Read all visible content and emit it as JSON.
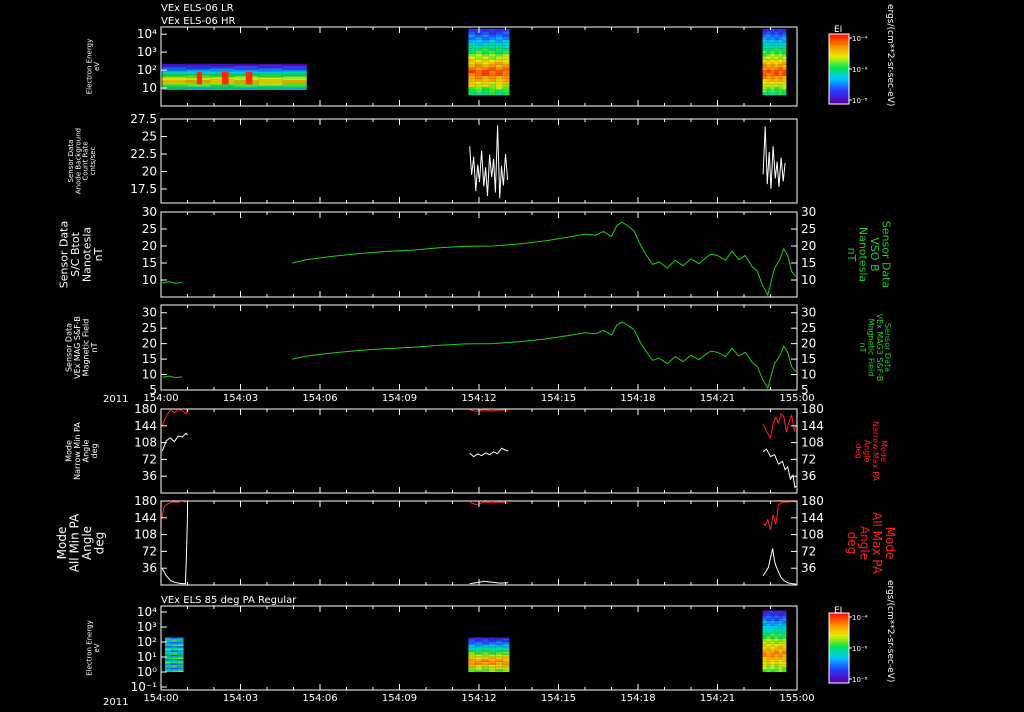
{
  "figure": {
    "header_lines": [
      "VEx ELS-06 LR",
      "VEx ELS-06 HR"
    ],
    "panel7_title": "VEx ELS 85 deg PA Regular",
    "year_label": "2011",
    "colorbar_label": "EI",
    "colorbar_unit": "ergs/(cm**2-sr-sec-eV)",
    "colorbar_ticks": [
      "10⁻⁴",
      "10⁻⁶",
      "10⁻⁸"
    ],
    "x_ticks": [
      "154:00",
      "154:03",
      "154:06",
      "154:09",
      "154:12",
      "154:15",
      "154:18",
      "154:21",
      "155:00"
    ]
  },
  "colors": {
    "background": "#000000",
    "axes": "#ffffff",
    "green": "#22cc22",
    "red": "#ff2020",
    "white": "#ffffff"
  },
  "chart_data": [
    {
      "type": "heatmap",
      "ylabel": [
        "Electron Energy",
        "eV"
      ],
      "yticks": [
        "10⁴",
        "10³",
        "10²",
        "10"
      ],
      "ylim_exp": [
        0,
        4.4
      ],
      "blocks": [
        {
          "x0": 0.05,
          "x1": 5.5,
          "e0": 0.9,
          "e1": 2.35,
          "style": "lr"
        },
        {
          "x0": 11.6,
          "x1": 13.15,
          "e0": 0.6,
          "e1": 4.3,
          "style": "hr"
        },
        {
          "x0": 22.7,
          "x1": 23.6,
          "e0": 0.6,
          "e1": 4.3,
          "style": "hr"
        }
      ]
    },
    {
      "type": "line",
      "ylabel": [
        "Sensor Data",
        "Anode Background",
        "Count Rate",
        "cnts/sec"
      ],
      "yticks": [
        17.5,
        20.0,
        22.5,
        25.0,
        27.5
      ],
      "ylim": [
        15.5,
        27.5
      ],
      "series": [
        {
          "color": "white",
          "segment": "a",
          "x": [
            11.65,
            11.72,
            11.8,
            11.88,
            11.95,
            12.02,
            12.1,
            12.18,
            12.25,
            12.32,
            12.4,
            12.48,
            12.55,
            12.62,
            12.7,
            12.78,
            12.85,
            12.92,
            13.0,
            13.08
          ],
          "y": [
            23.6,
            19.5,
            22.1,
            17.2,
            21.0,
            18.5,
            23.0,
            17.9,
            20.6,
            16.5,
            22.4,
            19.2,
            21.8,
            17.0,
            26.6,
            16.2,
            20.8,
            18.0,
            22.5,
            18.8
          ]
        },
        {
          "color": "white",
          "segment": "b",
          "x": [
            22.72,
            22.8,
            22.88,
            22.95,
            23.02,
            23.1,
            23.18,
            23.25,
            23.32,
            23.4,
            23.48,
            23.55
          ],
          "y": [
            19.6,
            26.4,
            18.2,
            22.8,
            17.5,
            23.6,
            19.0,
            21.4,
            17.8,
            22.0,
            18.6,
            21.2
          ]
        }
      ]
    },
    {
      "type": "line",
      "ylabel_left": [
        "Sensor Data",
        "S/C Btot",
        "Nanotesla",
        "nT"
      ],
      "ylabel_right": [
        "Sensor Data",
        "VSO B",
        "Nanotesla",
        "nT"
      ],
      "yticks": [
        10,
        15,
        20,
        25,
        30
      ],
      "ylim": [
        5,
        30
      ],
      "series": [
        {
          "color": "green",
          "x": [
            0.05,
            0.3,
            0.55,
            0.8
          ],
          "y": [
            9.1,
            9.5,
            9.0,
            9.3
          ]
        },
        {
          "color": "green",
          "x": [
            4.95,
            5.5,
            6.5,
            7.5,
            8.5,
            9.5,
            10.5,
            11.5,
            12.5,
            13.5,
            14.5,
            15.5,
            16.0,
            16.4,
            16.7,
            17.0,
            17.2,
            17.4,
            17.6,
            17.85,
            18.1,
            18.3,
            18.55,
            18.8,
            19.1,
            19.4,
            19.7,
            20.0,
            20.3,
            20.55,
            20.75,
            21.0,
            21.3,
            21.55,
            21.8,
            22.05,
            22.3,
            22.5,
            22.7,
            22.9,
            23.15,
            23.35,
            23.5,
            23.65,
            23.8,
            23.95
          ],
          "y": [
            15.0,
            16.0,
            17.0,
            17.8,
            18.4,
            18.8,
            19.5,
            19.9,
            20.0,
            20.6,
            21.5,
            22.8,
            23.5,
            23.2,
            24.3,
            22.8,
            26.0,
            27.0,
            26.0,
            24.5,
            20.2,
            17.5,
            14.6,
            15.3,
            13.5,
            15.8,
            14.2,
            16.2,
            14.8,
            16.5,
            17.6,
            17.2,
            15.8,
            18.5,
            16.0,
            17.2,
            14.0,
            12.6,
            8.5,
            5.6,
            13.5,
            16.0,
            19.2,
            17.2,
            12.5,
            11.0
          ]
        }
      ]
    },
    {
      "type": "line",
      "ylabel_left": [
        "Sensor Data",
        "VEx MAG S&F-B",
        "Magnetic Field",
        "nT"
      ],
      "ylabel_right": [
        "Sensor Data",
        "VEx MAG3 S&F-B",
        "Magnetic Field",
        "nT"
      ],
      "yticks": [
        5,
        10,
        15,
        20,
        25,
        30
      ],
      "ylim": [
        5,
        32.5
      ],
      "series": [
        {
          "color": "green",
          "x": [
            0.05,
            0.3,
            0.55,
            0.8
          ],
          "y": [
            9.1,
            9.5,
            9.0,
            9.3
          ]
        },
        {
          "color": "green",
          "x": [
            4.95,
            5.5,
            6.5,
            7.5,
            8.5,
            9.5,
            10.5,
            11.5,
            12.5,
            13.5,
            14.5,
            15.5,
            16.0,
            16.4,
            16.7,
            17.0,
            17.2,
            17.4,
            17.6,
            17.85,
            18.1,
            18.3,
            18.55,
            18.8,
            19.1,
            19.4,
            19.7,
            20.0,
            20.3,
            20.55,
            20.75,
            21.0,
            21.3,
            21.55,
            21.8,
            22.05,
            22.3,
            22.5,
            22.7,
            22.9,
            23.15,
            23.35,
            23.5,
            23.65,
            23.8,
            23.95
          ],
          "y": [
            15.0,
            16.0,
            17.0,
            17.8,
            18.4,
            18.8,
            19.5,
            19.9,
            20.0,
            20.6,
            21.5,
            22.8,
            23.5,
            23.2,
            24.3,
            22.8,
            26.0,
            27.0,
            26.0,
            24.5,
            20.2,
            17.5,
            14.6,
            15.3,
            13.5,
            15.8,
            14.2,
            16.2,
            14.8,
            16.5,
            17.6,
            17.2,
            15.8,
            18.5,
            16.0,
            17.2,
            14.0,
            12.6,
            8.5,
            5.6,
            13.5,
            16.0,
            19.2,
            17.2,
            12.5,
            11.0
          ]
        }
      ]
    },
    {
      "type": "line",
      "ylabel_left": [
        "Mode",
        "Narrow Min PA",
        "Angle",
        "deg"
      ],
      "ylabel_right": [
        "Mode",
        "Narrow Max PA",
        "Angle",
        "deg"
      ],
      "yticks": [
        36,
        72,
        108,
        144,
        180
      ],
      "ylim": [
        0,
        180
      ],
      "series": [
        {
          "color": "red",
          "x": [
            0.05,
            0.2,
            0.35,
            0.5,
            0.65,
            0.8,
            0.95,
            1.0
          ],
          "y": [
            145,
            165,
            178,
            172,
            179,
            176,
            170,
            180
          ]
        },
        {
          "color": "white",
          "x": [
            0.05,
            0.2,
            0.35,
            0.5,
            0.65,
            0.8,
            0.95,
            1.0
          ],
          "y": [
            90,
            112,
            118,
            110,
            122,
            120,
            128,
            124
          ]
        },
        {
          "color": "red",
          "x": [
            11.65,
            11.9,
            12.2,
            12.5,
            12.8,
            13.1
          ],
          "y": [
            178,
            175,
            178,
            176,
            178,
            177
          ]
        },
        {
          "color": "white",
          "x": [
            11.65,
            11.8,
            11.95,
            12.1,
            12.25,
            12.4,
            12.55,
            12.7,
            12.85,
            13.0,
            13.1
          ],
          "y": [
            85,
            78,
            84,
            80,
            86,
            82,
            88,
            84,
            96,
            92,
            90
          ]
        },
        {
          "color": "red",
          "x": [
            22.72,
            22.85,
            23.0,
            23.1,
            23.2,
            23.3,
            23.4,
            23.5,
            23.6,
            23.7,
            23.8,
            23.9,
            23.97
          ],
          "y": [
            148,
            132,
            118,
            148,
            162,
            150,
            170,
            164,
            130,
            152,
            166,
            134,
            145
          ]
        },
        {
          "color": "white",
          "x": [
            22.72,
            22.85,
            23.0,
            23.15,
            23.3,
            23.45,
            23.55,
            23.65,
            23.75,
            23.85,
            23.92,
            23.97
          ],
          "y": [
            88,
            94,
            78,
            82,
            62,
            68,
            50,
            56,
            30,
            38,
            12,
            15
          ]
        }
      ]
    },
    {
      "type": "line",
      "ylabel_left": [
        "Mode",
        "All Min PA",
        "Angle",
        "deg"
      ],
      "ylabel_right": [
        "Mode",
        "All Max PA",
        "Angle",
        "deg"
      ],
      "yticks": [
        36,
        72,
        108,
        144,
        180
      ],
      "ylim": [
        0,
        180
      ],
      "series": [
        {
          "color": "red",
          "x": [
            0.05,
            0.1,
            0.2,
            0.3,
            0.45,
            0.6,
            0.75,
            0.9,
            1.0
          ],
          "y": [
            145,
            165,
            172,
            175,
            178,
            177,
            179,
            178,
            179
          ]
        },
        {
          "color": "white",
          "x": [
            0.05,
            0.2,
            0.35,
            0.5,
            0.65,
            0.8,
            0.92,
            0.96,
            1.0,
            1.0
          ],
          "y": [
            35,
            20,
            10,
            6,
            4,
            3,
            3,
            60,
            150,
            178
          ]
        },
        {
          "color": "red",
          "x": [
            11.65,
            11.9,
            12.2,
            12.5,
            12.8,
            13.1
          ],
          "y": [
            177,
            172,
            178,
            176,
            178,
            175
          ]
        },
        {
          "color": "white",
          "x": [
            11.65,
            11.9,
            12.2,
            12.5,
            12.8,
            13.1
          ],
          "y": [
            3,
            5,
            8,
            6,
            4,
            5
          ]
        },
        {
          "color": "red",
          "x": [
            22.72,
            22.8,
            22.9,
            23.0,
            23.1,
            23.2,
            23.3,
            23.4,
            23.5,
            23.65,
            23.8,
            23.97
          ],
          "y": [
            132,
            128,
            140,
            118,
            150,
            130,
            172,
            176,
            178,
            177,
            179,
            178
          ]
        },
        {
          "color": "white",
          "x": [
            22.72,
            22.82,
            22.92,
            23.0,
            23.08,
            23.15,
            23.2,
            23.3,
            23.4,
            23.5,
            23.6,
            23.7,
            23.8,
            23.97
          ],
          "y": [
            20,
            28,
            38,
            58,
            78,
            52,
            42,
            28,
            16,
            10,
            6,
            4,
            3,
            2
          ]
        }
      ]
    },
    {
      "type": "heatmap",
      "ylabel": [
        "Electron Energy",
        "eV"
      ],
      "yticks": [
        "10⁴",
        "10³",
        "10²",
        "10¹",
        "10⁰",
        "10⁻¹"
      ],
      "ylim_exp": [
        -1.2,
        4.4
      ],
      "blocks": [
        {
          "x0": 0.15,
          "x1": 0.85,
          "e0": 0.0,
          "e1": 2.3,
          "style": "stripe"
        },
        {
          "x0": 11.6,
          "x1": 13.15,
          "e0": 0.0,
          "e1": 2.3,
          "style": "pa"
        },
        {
          "x0": 22.7,
          "x1": 23.6,
          "e0": 0.0,
          "e1": 4.1,
          "style": "pa"
        }
      ]
    }
  ]
}
